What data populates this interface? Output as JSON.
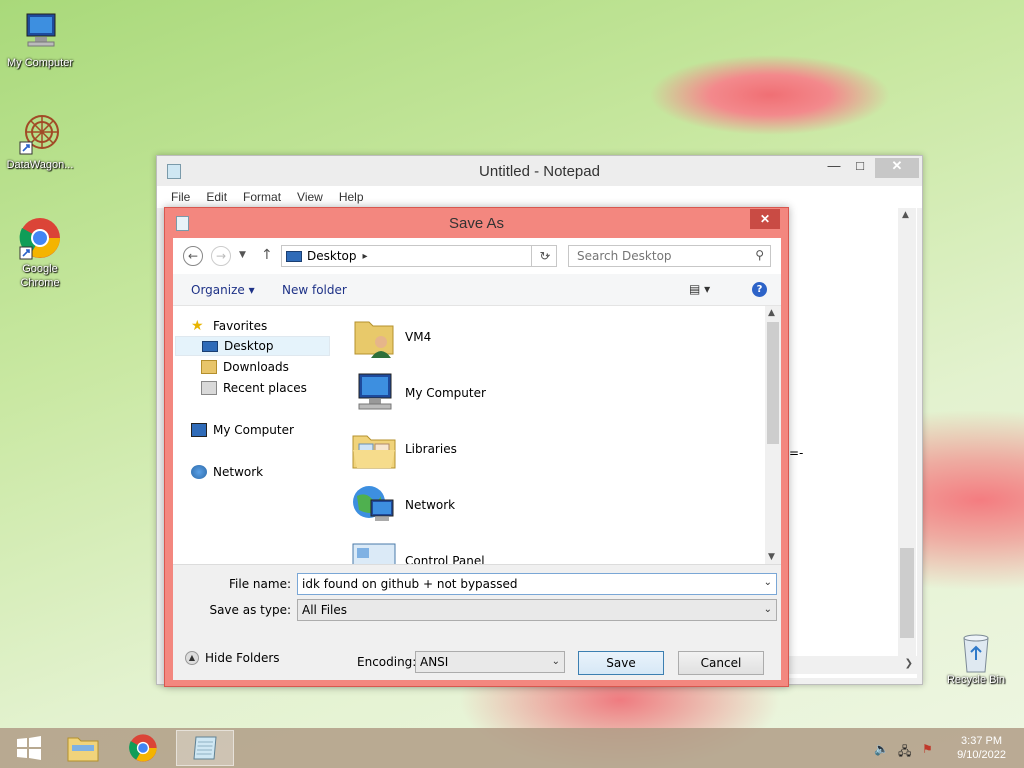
{
  "desktop": {
    "icons": [
      {
        "label": "My Computer"
      },
      {
        "label": "DataWagon..."
      },
      {
        "label": "Google Chrome"
      }
    ],
    "recycle_bin": "Recycle Bin"
  },
  "notepad": {
    "title": "Untitled - Notepad",
    "menu": [
      "File",
      "Edit",
      "Format",
      "View",
      "Help"
    ],
    "text_fragment": "=-"
  },
  "dialog": {
    "title": "Save As",
    "address": "Desktop",
    "search_placeholder": "Search Desktop",
    "toolbar": {
      "organize": "Organize",
      "new_folder": "New folder"
    },
    "nav": {
      "favorites": "Favorites",
      "desktop": "Desktop",
      "downloads": "Downloads",
      "recent": "Recent places",
      "my_computer": "My Computer",
      "network": "Network"
    },
    "files": [
      "VM4",
      "My Computer",
      "Libraries",
      "Network",
      "Control Panel"
    ],
    "file_name_label": "File name:",
    "file_name_value": "idk found on github + not bypassed",
    "save_type_label": "Save as type:",
    "save_type_value": "All Files",
    "hide_folders": "Hide Folders",
    "encoding_label": "Encoding:",
    "encoding_value": "ANSI",
    "save": "Save",
    "cancel": "Cancel"
  },
  "taskbar": {
    "time": "3:37 PM",
    "date": "9/10/2022"
  },
  "colors": {
    "dialog_frame": "#f3877f",
    "taskbar": "#b09c86"
  }
}
